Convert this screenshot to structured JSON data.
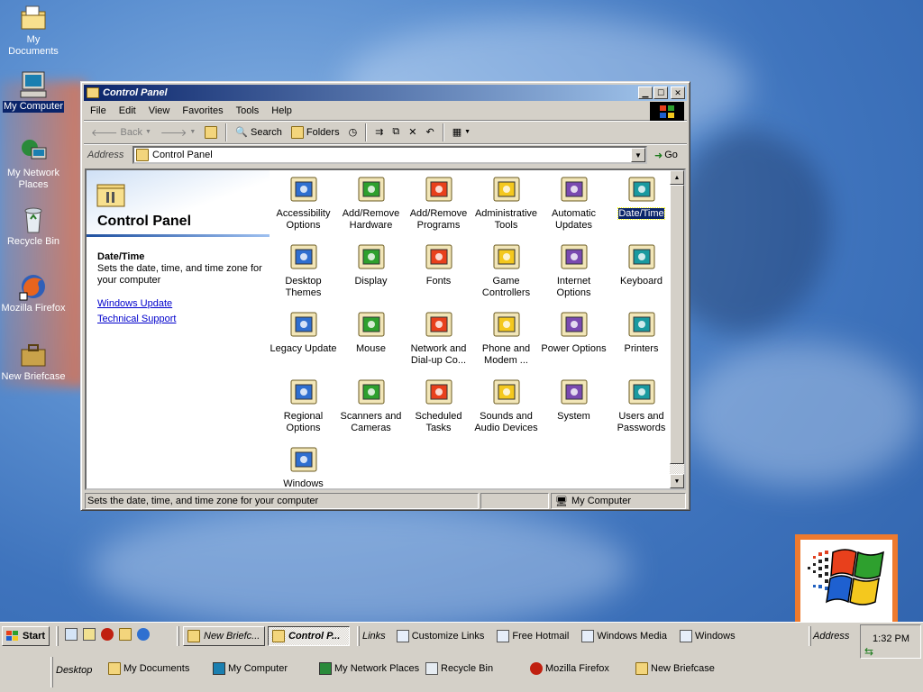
{
  "desktop": {
    "icons": [
      {
        "label": "My Documents",
        "icon": "my-documents-icon"
      },
      {
        "label": "My Computer",
        "icon": "my-computer-icon"
      },
      {
        "label": "My Network Places",
        "icon": "network-places-icon"
      },
      {
        "label": "Recycle Bin",
        "icon": "recycle-bin-icon"
      },
      {
        "label": "Mozilla Firefox",
        "icon": "firefox-icon"
      },
      {
        "label": "New Briefcase",
        "icon": "briefcase-icon"
      }
    ]
  },
  "window": {
    "title": "Control Panel",
    "menu": [
      "File",
      "Edit",
      "View",
      "Favorites",
      "Tools",
      "Help"
    ],
    "toolbar": {
      "back": "Back",
      "search": "Search",
      "folders": "Folders"
    },
    "address": {
      "label": "Address",
      "value": "Control Panel",
      "go": "Go"
    },
    "left_pane": {
      "heading": "Control Panel",
      "item_title": "Date/Time",
      "item_desc": "Sets the date, time, and time zone for your computer",
      "links": [
        "Windows Update",
        "Technical Support"
      ]
    },
    "items": [
      {
        "label": "Accessibility Options",
        "icon": "accessibility-icon"
      },
      {
        "label": "Add/Remove Hardware",
        "icon": "add-hardware-icon"
      },
      {
        "label": "Add/Remove Programs",
        "icon": "add-programs-icon"
      },
      {
        "label": "Administrative Tools",
        "icon": "admin-tools-icon"
      },
      {
        "label": "Automatic Updates",
        "icon": "windows-update-icon"
      },
      {
        "label": "Date/Time",
        "icon": "date-time-icon",
        "selected": true
      },
      {
        "label": "Desktop Themes",
        "icon": "desktop-themes-icon"
      },
      {
        "label": "Display",
        "icon": "display-icon"
      },
      {
        "label": "Fonts",
        "icon": "fonts-icon"
      },
      {
        "label": "Game Controllers",
        "icon": "joystick-icon"
      },
      {
        "label": "Internet Options",
        "icon": "internet-options-icon"
      },
      {
        "label": "Keyboard",
        "icon": "keyboard-icon"
      },
      {
        "label": "Legacy Update",
        "icon": "legacy-update-icon"
      },
      {
        "label": "Mouse",
        "icon": "mouse-icon"
      },
      {
        "label": "Network and Dial-up Co...",
        "icon": "network-icon"
      },
      {
        "label": "Phone and Modem ...",
        "icon": "phone-icon"
      },
      {
        "label": "Power Options",
        "icon": "power-icon"
      },
      {
        "label": "Printers",
        "icon": "printer-icon"
      },
      {
        "label": "Regional Options",
        "icon": "globe-icon"
      },
      {
        "label": "Scanners and Cameras",
        "icon": "scanner-icon"
      },
      {
        "label": "Scheduled Tasks",
        "icon": "scheduled-tasks-icon"
      },
      {
        "label": "Sounds and Audio Devices",
        "icon": "speaker-icon"
      },
      {
        "label": "System",
        "icon": "system-icon"
      },
      {
        "label": "Users and Passwords",
        "icon": "users-icon"
      },
      {
        "label": "Windows",
        "icon": "windows-user-icon"
      }
    ],
    "status": {
      "text": "Sets the date, time, and time zone for your computer",
      "zone": "My Computer"
    }
  },
  "taskbar": {
    "start": "Start",
    "tasks": [
      {
        "label": "New Briefc...",
        "active": false
      },
      {
        "label": "Control P...",
        "active": true
      }
    ],
    "links_label": "Links",
    "links": [
      "Customize Links",
      "Free Hotmail",
      "Windows Media",
      "Windows"
    ],
    "address_label": "Address",
    "clock": "1:32 PM",
    "desktop_label": "Desktop",
    "desktop_links": [
      "My Documents",
      "My Computer",
      "My Network Places",
      "Recycle Bin",
      "Mozilla Firefox",
      "New Briefcase"
    ]
  },
  "colors": {
    "title_start": "#0a246a",
    "title_end": "#a6caf0",
    "selection": "#0a246a",
    "link": "#0000cc"
  }
}
